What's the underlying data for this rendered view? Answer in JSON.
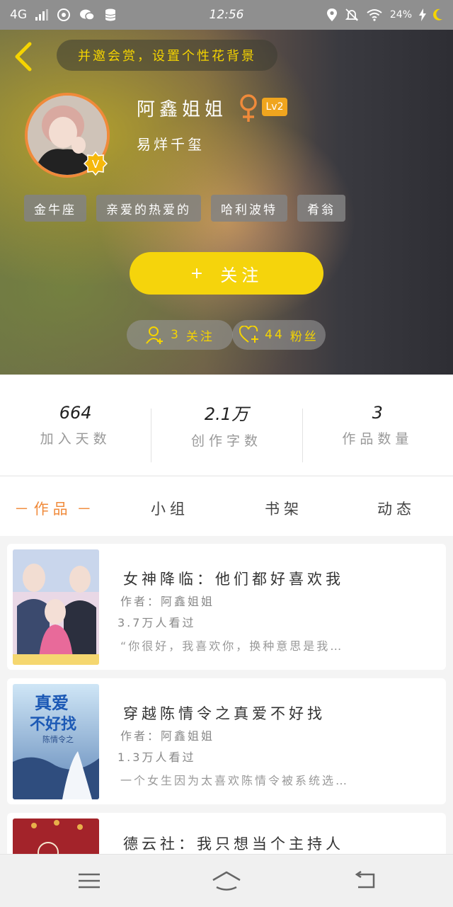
{
  "status_bar": {
    "network": "4G",
    "time": "12:56",
    "battery": "24%"
  },
  "header": {
    "bg_hint": "并邀会赏，设置个性花背景",
    "name": "阿鑫姐姐",
    "level": "Lv2",
    "subtitle": "易烊千玺",
    "tags": [
      "金牛座",
      "亲爱的热爱的",
      "哈利波特",
      "肴翁"
    ],
    "follow_label": "关注",
    "following": {
      "count": "3",
      "label": "关注"
    },
    "fans": {
      "count": "44",
      "label": "粉丝"
    },
    "verified_badge": "V"
  },
  "stats": [
    {
      "value": "664",
      "label": "加入天数"
    },
    {
      "value": "2.1万",
      "label": "创作字数"
    },
    {
      "value": "3",
      "label": "作品数量"
    }
  ],
  "tabs": [
    "作品",
    "小组",
    "书架",
    "动态"
  ],
  "works": [
    {
      "title": "女神降临：他们都好喜欢我",
      "author": "作者：阿鑫姐姐",
      "views": "3.7万人看过",
      "desc": "“你很好，我喜欢你，换种意思是我…"
    },
    {
      "title": "穿越陈情令之真爱不好找",
      "author": "作者：阿鑫姐姐",
      "views": "1.3万人看过",
      "desc": "一个女生因为太喜欢陈情令被系统选…",
      "cover_text": [
        "真爱",
        "不好找",
        "陈情令之"
      ]
    },
    {
      "title": "德云社：我只想当个主持人"
    }
  ],
  "colors": {
    "accent": "#f5d40c",
    "orange": "#f08a3a"
  }
}
